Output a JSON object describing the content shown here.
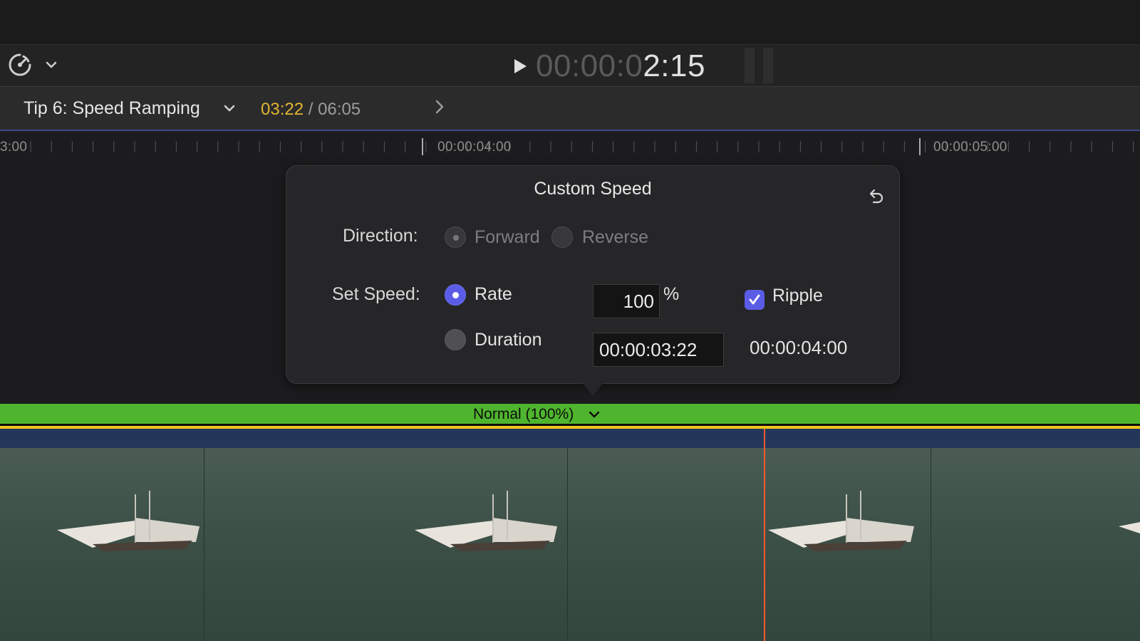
{
  "toolbar": {
    "speed_icon": "speedometer-icon",
    "timecode_dim": "00:00:0",
    "timecode_bright": "2:15"
  },
  "project": {
    "title": "Tip 6: Speed Ramping",
    "current_time": "03:22",
    "separator": " / ",
    "total_time": "06:05"
  },
  "ruler": {
    "labels": [
      "3:00",
      "00:00:04:00",
      "00:00:05:00"
    ]
  },
  "popover": {
    "title": "Custom Speed",
    "direction_label": "Direction:",
    "direction_options": [
      "Forward",
      "Reverse"
    ],
    "set_speed_label": "Set Speed:",
    "rate_label": "Rate",
    "rate_value": "100",
    "percent": "%",
    "ripple_label": "Ripple",
    "ripple_checked": true,
    "duration_label": "Duration",
    "duration_value": "00:00:03:22",
    "end_time": "00:00:04:00"
  },
  "retime": {
    "label": "Normal (100%)",
    "color": "#4fb52e"
  },
  "colors": {
    "accent": "#5b5ce6",
    "playhead": "#ff5a2a",
    "current_time": "#e2b634"
  }
}
